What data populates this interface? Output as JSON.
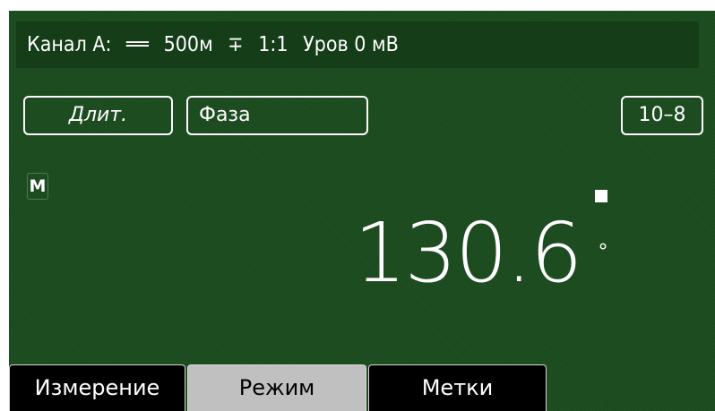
{
  "status_bar": {
    "channel": "Канал А:",
    "coupling_symbol": "══",
    "range": "500м",
    "probe_symbol": "∓",
    "attenuation": "1:1",
    "level": "Уров 0 мВ"
  },
  "buttons": {
    "duration": "Длит.",
    "phase": "Фаза",
    "range": "10–8"
  },
  "mode_badge": "М",
  "reading": {
    "value": "130.6",
    "unit": "°"
  },
  "tabs": {
    "measurement": "Измерение",
    "mode": "Режим",
    "marks": "Метки"
  },
  "colors": {
    "screen_background": "#1a4a1e",
    "status_bar_background": "#143d18",
    "selected_tab": "#c0c0c0",
    "tab_background": "#000000"
  }
}
